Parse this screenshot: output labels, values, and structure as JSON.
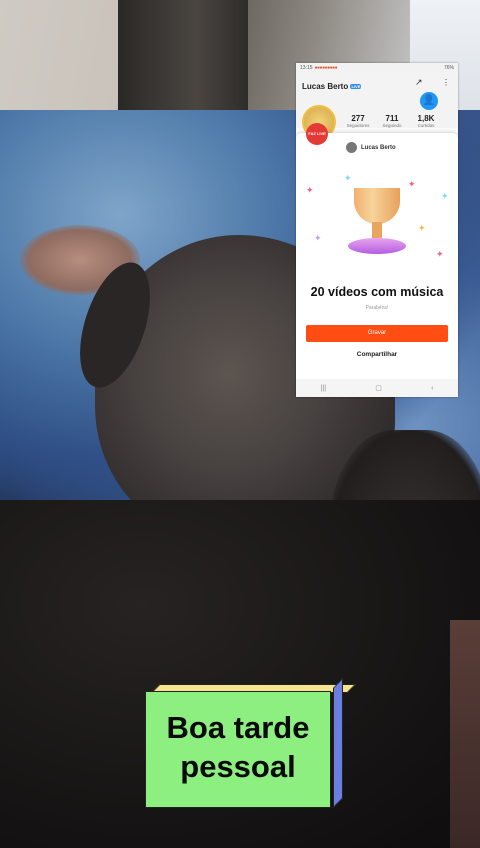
{
  "status_bar": {
    "time": "13:15",
    "battery": "76%"
  },
  "profile": {
    "name": "Lucas Berto",
    "badge": "LIVE",
    "live_badge": "FAZ LIVE",
    "stats": [
      {
        "value": "277",
        "label": "Seguidores"
      },
      {
        "value": "711",
        "label": "Seguindo"
      },
      {
        "value": "1,8K",
        "label": "Curtidas"
      }
    ]
  },
  "modal": {
    "user": "Lucas Berto",
    "title": "20 vídeos com música",
    "subtitle": "Parabéns!",
    "primary_button": "Gravar",
    "secondary_button": "Compartilhar"
  },
  "navbar": {
    "recent": "|||",
    "home": "▢",
    "back": "‹"
  },
  "caption": {
    "line1": "Boa tarde",
    "line2": "pessoal"
  },
  "colors": {
    "accent": "#ff4d14",
    "caption_bg": "#8cef7f",
    "caption_top": "#f6e58d",
    "caption_side": "#6b7fe0"
  }
}
